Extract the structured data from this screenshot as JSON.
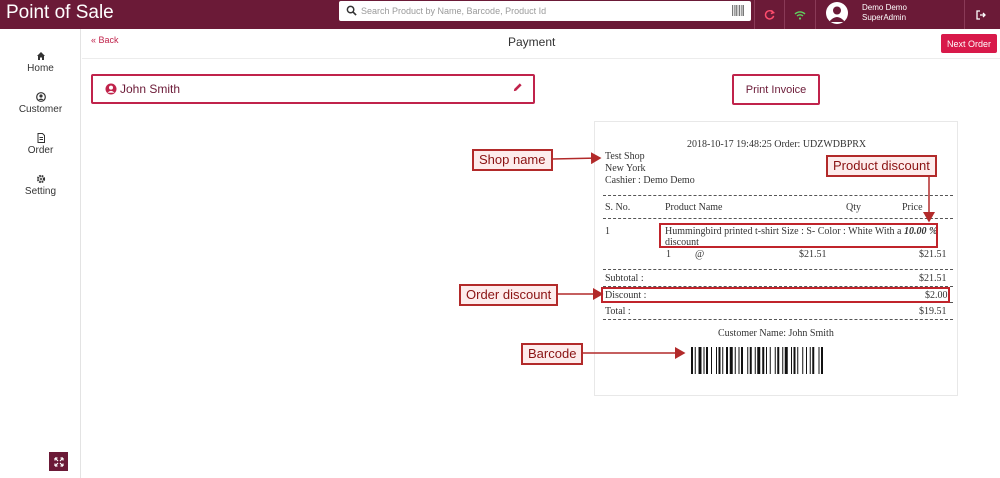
{
  "header": {
    "brand": "Point of Sale",
    "search_placeholder": "Search Product by Name, Barcode, Product Id",
    "user_name": "Demo Demo",
    "user_role": "SuperAdmin",
    "bg_color": "#6b1a37"
  },
  "sidebar": {
    "items": [
      {
        "label": "Home",
        "icon": "home-icon"
      },
      {
        "label": "Customer",
        "icon": "user-icon"
      },
      {
        "label": "Order",
        "icon": "document-icon"
      },
      {
        "label": "Setting",
        "icon": "gear-icon"
      }
    ]
  },
  "main": {
    "back_label": "Back",
    "title": "Payment",
    "next_order_label": "Next Order",
    "customer_name": "John Smith",
    "print_invoice_label": "Print Invoice"
  },
  "receipt": {
    "datetime_order": "2018-10-17 19:48:25 Order: UDZWDBPRX",
    "shop_name": "Test Shop",
    "city": "New York",
    "cashier": "Cashier : Demo Demo",
    "col_sno": "S. No.",
    "col_product": "Product Name",
    "col_qty": "Qty",
    "col_price": "Price",
    "line_sno": "1",
    "line_product_text": "Hummingbird printed t-shirt Size : S- Color : White With a ",
    "line_discount_pct": "10.00 %",
    "line_discount_word": "discount",
    "line_qty": "1",
    "line_at": "@",
    "line_unit_price": "$21.51",
    "line_total": "$21.51",
    "subtotal_label": "Subtotal :",
    "subtotal_value": "$21.51",
    "discount_label": "Discount :",
    "discount_value": "$2.00",
    "total_label": "Total :",
    "total_value": "$19.51",
    "customer_line": "Customer Name: John Smith"
  },
  "annotations": {
    "shop_name": "Shop name",
    "product_discount": "Product discount",
    "order_discount": "Order discount",
    "barcode": "Barcode"
  }
}
